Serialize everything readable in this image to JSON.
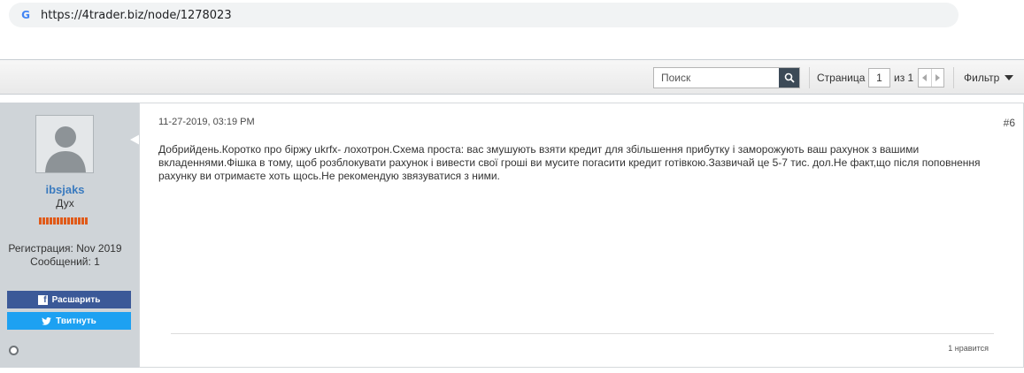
{
  "browser": {
    "url": "https://4trader.biz/node/1278023",
    "icon": "google-g-icon"
  },
  "toolbar": {
    "search_placeholder": "Поиск",
    "page_label": "Страница",
    "page_value": "1",
    "of_label": "из 1",
    "filter_label": "Фильтр"
  },
  "post": {
    "username": "ibsjaks",
    "user_title": "Дух",
    "registration": "Регистрация: Nov 2019",
    "messages": "Сообщений: 1",
    "share_label": "Расшарить",
    "tweet_label": "Твитнуть",
    "date": "11-27-2019, 03:19 PM",
    "number": "#6",
    "text": "Добрийдень.Коротко про біржу ukrfx- лохотрон.Схема проста: вас змушують взяти кредит для збільшення прибутку і заморожують ваш рахунок з вашими вкладеннями.Фішка в тому, щоб розблокувати рахунок і вивести свої гроші ви мусите погасити кредит готівкою.Зазвичай це 5-7 тис. дол.Не факт,що після поповнення рахунку ви отримаєте хоть щось.Не рекомендую звязуватися з ними.",
    "likes": "1 нравится"
  },
  "colors": {
    "username": "#3b7bbf",
    "facebook": "#3b5998",
    "twitter": "#1da1f2",
    "reputation": "#e05a19"
  }
}
